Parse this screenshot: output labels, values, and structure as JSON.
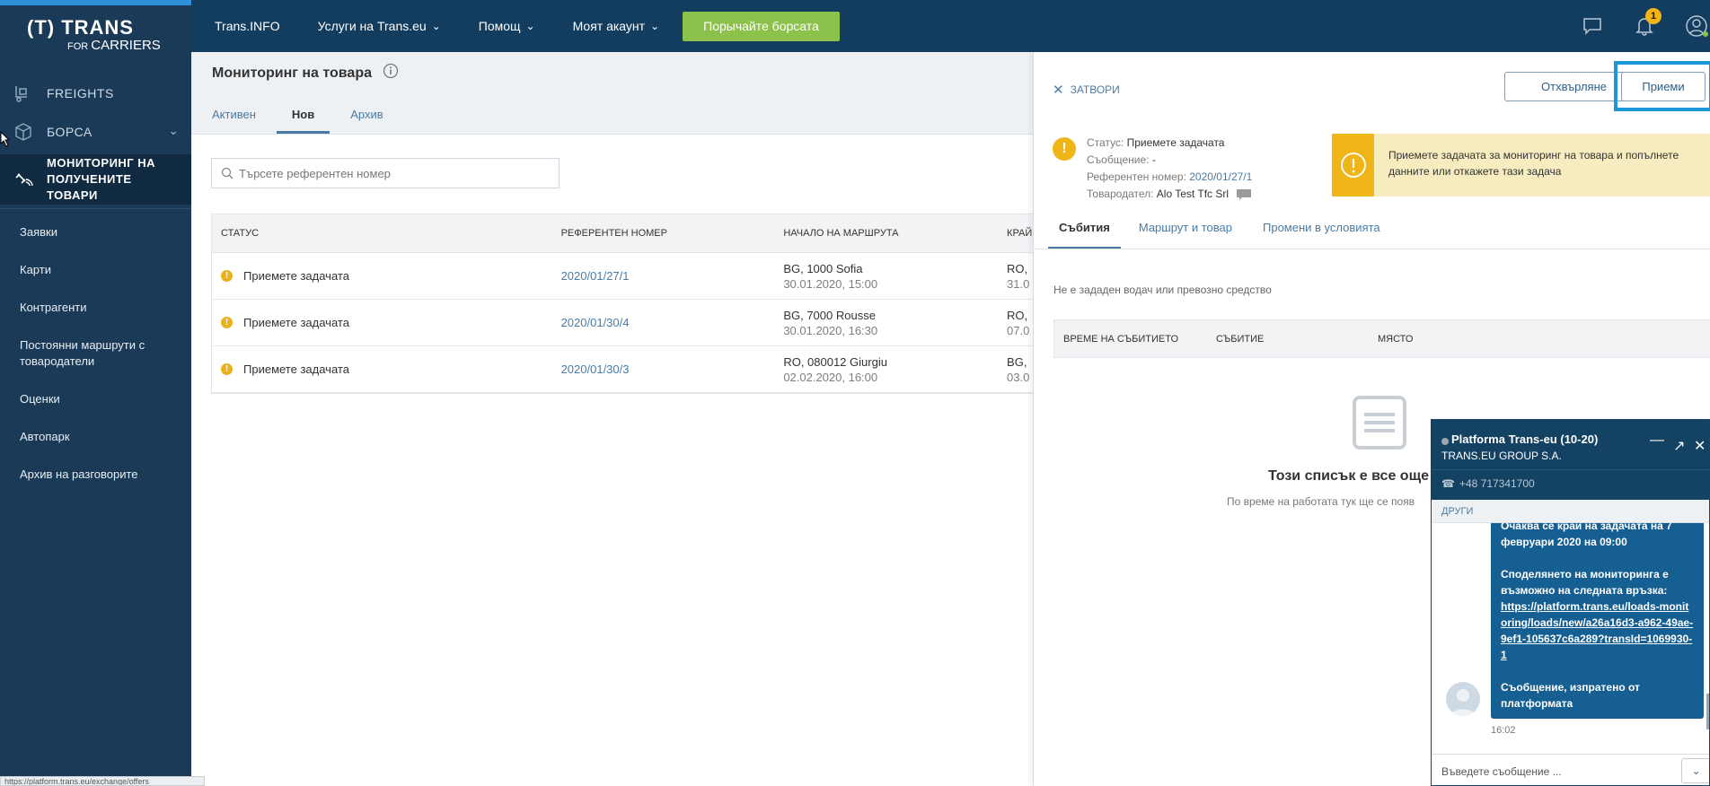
{
  "sidebar": {
    "logo_brand": "(T) TRANS",
    "logo_for": "FOR",
    "logo_carriers": "CARRIERS",
    "main_items": [
      {
        "label": "FREIGHTS",
        "icon": "freights-icon"
      },
      {
        "label": "БОРСА",
        "icon": "box-icon"
      },
      {
        "label": "МОНИТОРИНГ НА ПОЛУЧЕНИТЕ ТОВАРИ",
        "icon": "satellite-icon"
      }
    ],
    "sub_items": [
      "Заявки",
      "Карти",
      "Контрагенти",
      "Постоянни маршрути с товародатели",
      "Оценки",
      "Автопарк",
      "Архив на разговорите"
    ]
  },
  "topbar": {
    "nav": [
      "Trans.INFO",
      "Услуги на Trans.eu",
      "Помощ",
      "Моят акаунт"
    ],
    "cta": "Порычайте борсата",
    "notifications_count": "1"
  },
  "main": {
    "title": "Мониторинг на товара",
    "tabs": [
      "Активен",
      "Нов",
      "Архив"
    ],
    "active_tab": "Нов",
    "search_placeholder": "Търсете референтен номер",
    "columns": [
      "СТАТУС",
      "РЕФЕРЕНТЕН НОМЕР",
      "НАЧАЛО НА МАРШРУТА",
      "КРАЙ"
    ],
    "rows": [
      {
        "status": "Приемете задачата",
        "ref": "2020/01/27/1",
        "start": "BG, 1000 Sofia",
        "start_time": "30.01.2020, 15:00",
        "end": "RO,",
        "end_time": "31.0"
      },
      {
        "status": "Приемете задачата",
        "ref": "2020/01/30/4",
        "start": "BG, 7000 Rousse",
        "start_time": "30.01.2020, 16:30",
        "end": "RO,",
        "end_time": "07.0"
      },
      {
        "status": "Приемете задачата",
        "ref": "2020/01/30/3",
        "start": "RO, 080012 Giurgiu",
        "start_time": "02.02.2020, 16:00",
        "end": "BG,",
        "end_time": "03.0"
      }
    ]
  },
  "panel": {
    "close": "ЗАТВОРИ",
    "reject": "Отхвърляне",
    "accept": "Приеми",
    "status_label": "Статус:",
    "status_value": "Приемете задачата",
    "message_label": "Съобщение:",
    "message_value": "-",
    "ref_label": "Референтен номер:",
    "ref_value": "2020/01/27/1",
    "shipper_label": "Товародател:",
    "shipper_value": "Alo Test Tfc Srl",
    "alert": "Приемете задачата за мониторинг на товара и попълнете данните или откажете тази задача",
    "tabs": [
      "Събития",
      "Маршрут и товар",
      "Промени в условията"
    ],
    "no_driver": "Не е зададен водач или превозно средство",
    "event_columns": [
      "ВРЕМЕ НА СЪБИТИЕТО",
      "СЪБИТИЕ",
      "МЯСТО"
    ],
    "empty_title": "Този списък е все още",
    "empty_sub": "По време на работата тук ще се появ"
  },
  "chat": {
    "name": "Platforma Trans-eu (10-20)",
    "company": "TRANS.EU GROUP S.A.",
    "phone": "+48 717341700",
    "others": "ДРУГИ",
    "msg_top": "Очаква се край на задачата на 7 февруари 2020 на 09:00",
    "msg_share": "Споделянето на мониторинга е възможно на следната връзка:",
    "msg_url": "https://platform.trans.eu/loads-monitoring/loads/new/a26a16d3-a962-49ae-9ef1-105637c6a289?transId=1069930-1",
    "msg_sent": "Съобщение, изпратено от платформата",
    "time": "16:02",
    "input_placeholder": "Въведете съобщение ..."
  },
  "status_bar_url": "https://platform.trans.eu/exchange/offers"
}
